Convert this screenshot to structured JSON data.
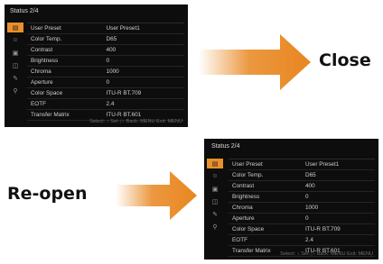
{
  "panels": [
    {
      "title": "Status 2/4",
      "icons": [
        "camera-menu-icon",
        "person-icon",
        "media-icon",
        "tv-icon",
        "edit-icon",
        "key-icon"
      ],
      "rows": [
        {
          "key": "User Preset",
          "value": "User Preset1"
        },
        {
          "key": "Color Temp.",
          "value": "D65"
        },
        {
          "key": "Contrast",
          "value": "400"
        },
        {
          "key": "Brightness",
          "value": "0"
        },
        {
          "key": "Chroma",
          "value": "1000"
        },
        {
          "key": "Aperture",
          "value": "0"
        },
        {
          "key": "Color Space",
          "value": "ITU-R BT.709"
        },
        {
          "key": "EOTF",
          "value": "2.4"
        },
        {
          "key": "Transfer Matrix",
          "value": "ITU-R BT.601"
        }
      ],
      "footer": "Select: ↕ Set: ▷ Back: MENU Exit: MENU"
    },
    {
      "title": "Status 2/4",
      "icons": [
        "camera-menu-icon",
        "person-icon",
        "media-icon",
        "tv-icon",
        "edit-icon",
        "key-icon"
      ],
      "rows": [
        {
          "key": "User Preset",
          "value": "User Preset1"
        },
        {
          "key": "Color Temp.",
          "value": "D65"
        },
        {
          "key": "Contrast",
          "value": "400"
        },
        {
          "key": "Brightness",
          "value": "0"
        },
        {
          "key": "Chroma",
          "value": "1000"
        },
        {
          "key": "Aperture",
          "value": "0"
        },
        {
          "key": "Color Space",
          "value": "ITU-R BT.709"
        },
        {
          "key": "EOTF",
          "value": "2.4"
        },
        {
          "key": "Transfer Matrix",
          "value": "ITU-R BT.601"
        }
      ],
      "footer": "Select: ↕ Set: ▷ Back: MENU Exit: MENU"
    }
  ],
  "labels": {
    "close": "Close",
    "reopen": "Re-open"
  },
  "colors": {
    "accent": "#e8902a",
    "arrow": "#e8861f"
  }
}
